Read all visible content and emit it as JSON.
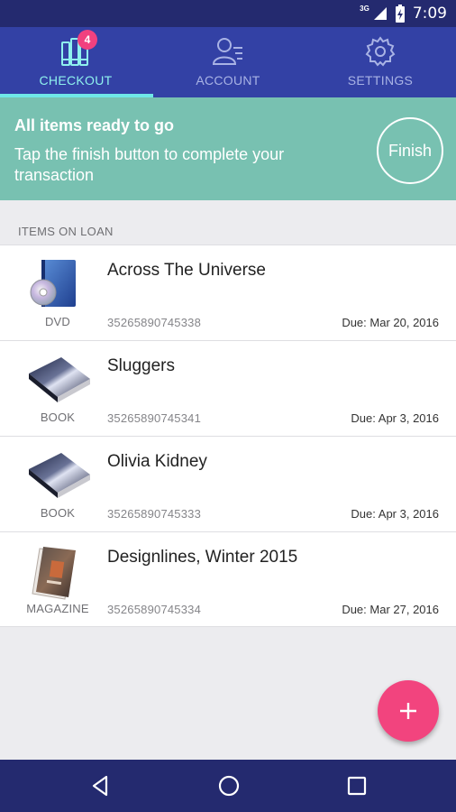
{
  "status_bar": {
    "network": "3G",
    "time": "7:09"
  },
  "tabs": [
    {
      "label": "CHECKOUT",
      "badge": "4",
      "icon": "books-icon",
      "active": true
    },
    {
      "label": "ACCOUNT",
      "icon": "account-icon",
      "active": false
    },
    {
      "label": "SETTINGS",
      "icon": "gear-icon",
      "active": false
    }
  ],
  "banner": {
    "title": "All items ready to go",
    "message": "Tap the finish button to complete your transaction",
    "finish_label": "Finish"
  },
  "section": {
    "header": "ITEMS ON LOAN"
  },
  "items": [
    {
      "title": "Across The Universe",
      "type": "DVD",
      "id": "35265890745338",
      "due": "Due: Mar 20, 2016",
      "thumb": "dvd-icon"
    },
    {
      "title": "Sluggers",
      "type": "BOOK",
      "id": "35265890745341",
      "due": "Due: Apr 3, 2016",
      "thumb": "book-icon"
    },
    {
      "title": "Olivia Kidney",
      "type": "BOOK",
      "id": "35265890745333",
      "due": "Due: Apr 3, 2016",
      "thumb": "book-icon"
    },
    {
      "title": "Designlines, Winter 2015",
      "type": "MAGAZINE",
      "id": "35265890745334",
      "due": "Due: Mar 27, 2016",
      "thumb": "magazine-icon"
    }
  ],
  "fab": {
    "icon": "plus-icon"
  },
  "nav": {
    "icons": [
      "back-icon",
      "home-icon",
      "recents-icon"
    ]
  },
  "colors": {
    "status_bar": "#242a6f",
    "tab_bar": "#3341a5",
    "active_tab": "#8ff2ee",
    "banner": "#78c1b1",
    "accent": "#f2447e",
    "badge": "#f1417f"
  }
}
